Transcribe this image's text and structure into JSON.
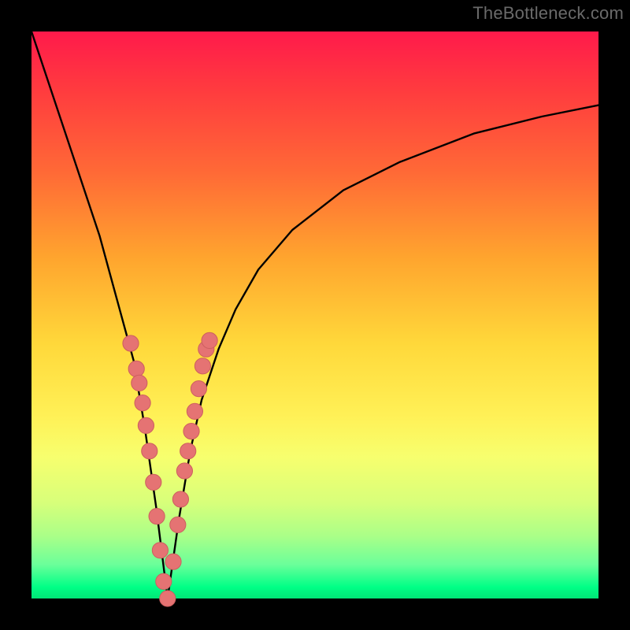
{
  "watermark": "TheBottleneck.com",
  "colors": {
    "frame": "#000000",
    "curve": "#000000",
    "marker_fill": "#e57373",
    "marker_stroke": "#cc5f5f",
    "gradient_top": "#ff1a4b",
    "gradient_bottom": "#00e676"
  },
  "chart_data": {
    "type": "line",
    "title": "",
    "xlabel": "",
    "ylabel": "",
    "xlim": [
      0,
      100
    ],
    "ylim": [
      0,
      100
    ],
    "grid": false,
    "legend": false,
    "optimum_x": 24,
    "curve": {
      "name": "bottleneck-curve",
      "x": [
        0,
        4,
        8,
        12,
        15,
        18,
        20,
        22,
        24,
        26,
        28,
        30,
        33,
        36,
        40,
        46,
        55,
        65,
        78,
        90,
        100
      ],
      "y": [
        100,
        88,
        76,
        64,
        53,
        42,
        30,
        16,
        0,
        14,
        26,
        35,
        44,
        51,
        58,
        65,
        72,
        77,
        82,
        85,
        87
      ]
    },
    "markers_x": [
      17.5,
      18.5,
      19.0,
      19.6,
      20.2,
      20.8,
      21.5,
      22.1,
      22.7,
      23.3,
      24.0,
      25.0,
      25.8,
      26.3,
      27.0,
      27.6,
      28.2,
      28.8,
      29.5,
      30.2,
      30.8,
      31.4
    ],
    "markers_y": [
      45.0,
      40.5,
      38.0,
      34.5,
      30.5,
      26.0,
      20.5,
      14.5,
      8.5,
      3.0,
      0.0,
      6.5,
      13.0,
      17.5,
      22.5,
      26.0,
      29.5,
      33.0,
      37.0,
      41.0,
      44.0,
      45.5
    ],
    "marker_radius": 1.4
  }
}
